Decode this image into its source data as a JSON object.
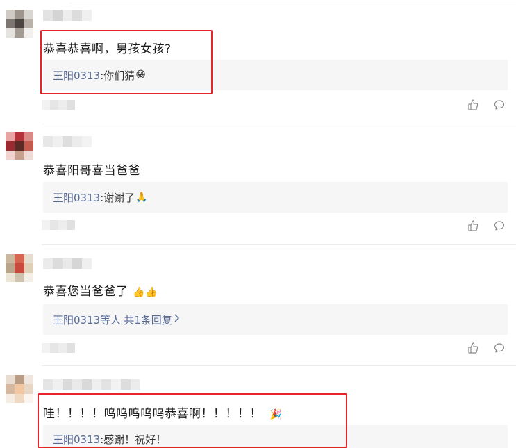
{
  "comments": [
    {
      "text": "恭喜恭喜啊，男孩女孩?",
      "reply_author": "王阳0313",
      "reply_text": ":你们猜",
      "reply_emoji": "😁",
      "like_icon": "thumbs-up-icon",
      "comment_icon": "comment-bubble-icon"
    },
    {
      "text": "恭喜阳哥喜当爸爸",
      "reply_author": "王阳0313",
      "reply_text": ":谢谢了",
      "reply_emoji": "🙏",
      "like_icon": "thumbs-up-icon",
      "comment_icon": "comment-bubble-icon"
    },
    {
      "text": "恭喜您当爸爸了",
      "text_emoji": "👍👍",
      "reply_author": "王阳0313等人",
      "reply_more": "共1条回复",
      "reply_more_icon": "chevron-right-icon",
      "like_icon": "thumbs-up-icon",
      "comment_icon": "comment-bubble-icon"
    },
    {
      "text": "哇！！！！呜呜呜呜呜恭喜啊！！！！！",
      "text_emoji": "🎉",
      "reply_author": "王阳0313",
      "reply_text": ":感谢！祝好！"
    }
  ],
  "colors": {
    "highlight_border": "#e8232c",
    "reply_author": "#576b95",
    "reply_background": "#f6f6f6"
  }
}
